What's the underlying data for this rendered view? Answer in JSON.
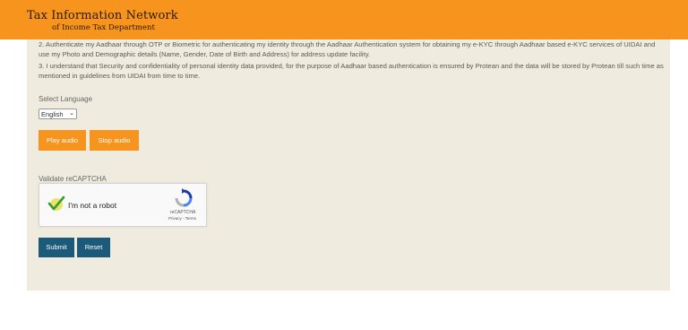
{
  "header": {
    "title": "Tax Information Network",
    "subtitle": "of Income Tax Department",
    "background_color": "#f7941d"
  },
  "consent": {
    "paragraph_2": "2. Authenticate my Aadhaar through OTP or Biometric for authenticating my identity through the Aadhaar Authentication system for obtaining my e-KYC through Aadhaar based e-KYC services of UIDAI and use my Photo and Demographic details (Name, Gender, Date of Birth and Address) for address update facility.",
    "paragraph_3": "3. I understand that Security and confidentiality of personal identity data provided, for the purpose of Aadhaar based authentication is ensured by Protean and the data will be stored by Protean till such time as mentioned in guidelines from UIDAI from time to time."
  },
  "language": {
    "label": "Select Language",
    "selected": "English"
  },
  "audio": {
    "play_label": "Play audio",
    "stop_label": "Stop audio"
  },
  "recaptcha": {
    "label": "Validate reCAPTCHA",
    "checkbox_text": "I'm not a robot",
    "brand": "reCAPTCHA",
    "links": "Privacy - Terms",
    "checked": true
  },
  "actions": {
    "submit_label": "Submit",
    "reset_label": "Reset"
  },
  "colors": {
    "accent": "#f7941d",
    "primary_button": "#1c5a7a",
    "panel_background": "#efecdf"
  }
}
